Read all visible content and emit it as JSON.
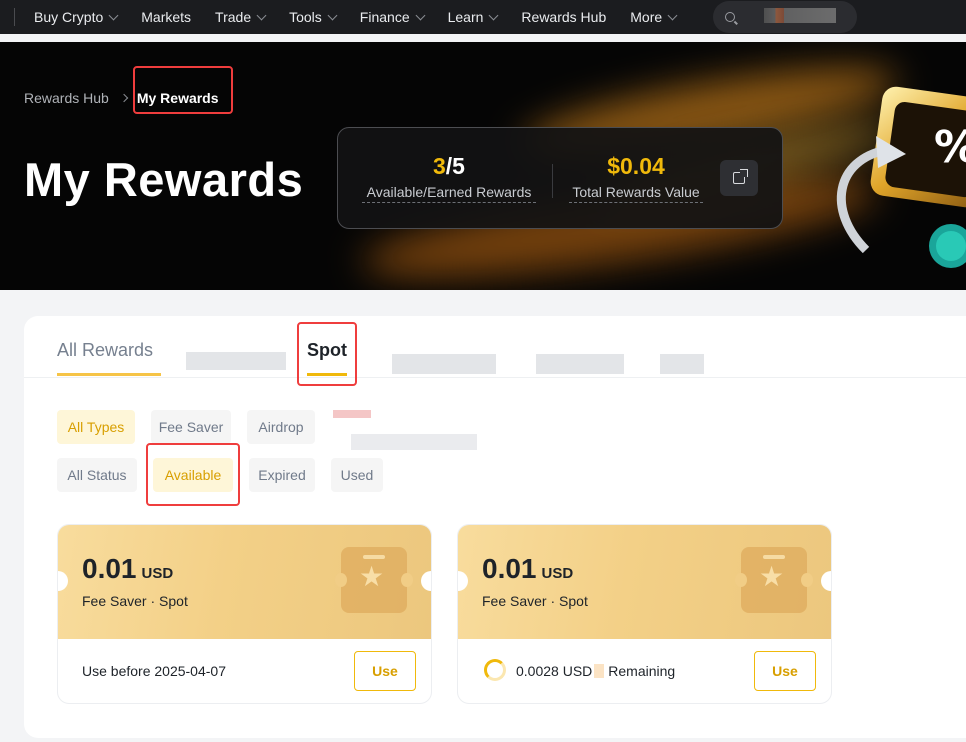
{
  "nav": {
    "items": [
      "Buy Crypto",
      "Markets",
      "Trade",
      "Tools",
      "Finance",
      "Learn",
      "Rewards Hub",
      "More"
    ],
    "has_dropdown": [
      true,
      false,
      true,
      true,
      true,
      true,
      false,
      true
    ]
  },
  "breadcrumb": {
    "parent": "Rewards Hub",
    "current": "My Rewards"
  },
  "hero": {
    "title": "My Rewards",
    "stats": {
      "available": "3",
      "earned": "/5",
      "available_label": "Available/Earned Rewards",
      "value": "$0.04",
      "value_label": "Total Rewards Value"
    }
  },
  "tabs": {
    "all": "All Rewards",
    "spot": "Spot"
  },
  "filters": {
    "types": [
      "All Types",
      "Fee Saver",
      "Airdrop"
    ],
    "status": [
      "All Status",
      "Available",
      "Expired",
      "Used"
    ],
    "active_type": "All Types",
    "active_status": "Available"
  },
  "coupons": [
    {
      "amount": "0.01",
      "unit": "USD",
      "type": "Fee Saver · Spot",
      "footer": "Use before 2025-04-07",
      "button": "Use"
    },
    {
      "amount": "0.01",
      "unit": "USD",
      "type": "Fee Saver · Spot",
      "remaining_amount": "0.0028 USD",
      "remaining_label": "Remaining",
      "button": "Use"
    }
  ],
  "colors": {
    "accent": "#f0b90b",
    "highlight": "#ef3d3d",
    "nav_bg": "#1b1c1f"
  }
}
